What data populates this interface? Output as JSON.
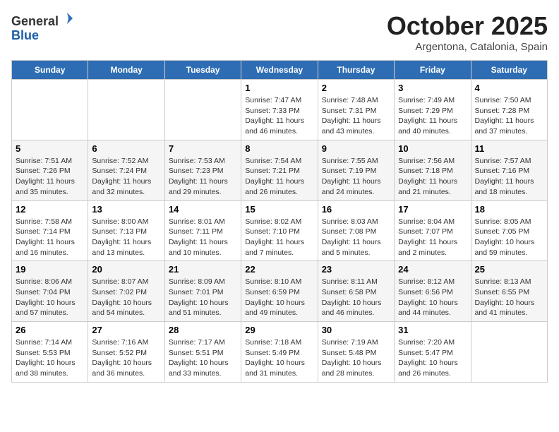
{
  "header": {
    "logo_line1": "General",
    "logo_line2": "Blue",
    "month": "October 2025",
    "location": "Argentona, Catalonia, Spain"
  },
  "days_of_week": [
    "Sunday",
    "Monday",
    "Tuesday",
    "Wednesday",
    "Thursday",
    "Friday",
    "Saturday"
  ],
  "weeks": [
    [
      {
        "day": "",
        "info": ""
      },
      {
        "day": "",
        "info": ""
      },
      {
        "day": "",
        "info": ""
      },
      {
        "day": "1",
        "info": "Sunrise: 7:47 AM\nSunset: 7:33 PM\nDaylight: 11 hours and 46 minutes."
      },
      {
        "day": "2",
        "info": "Sunrise: 7:48 AM\nSunset: 7:31 PM\nDaylight: 11 hours and 43 minutes."
      },
      {
        "day": "3",
        "info": "Sunrise: 7:49 AM\nSunset: 7:29 PM\nDaylight: 11 hours and 40 minutes."
      },
      {
        "day": "4",
        "info": "Sunrise: 7:50 AM\nSunset: 7:28 PM\nDaylight: 11 hours and 37 minutes."
      }
    ],
    [
      {
        "day": "5",
        "info": "Sunrise: 7:51 AM\nSunset: 7:26 PM\nDaylight: 11 hours and 35 minutes."
      },
      {
        "day": "6",
        "info": "Sunrise: 7:52 AM\nSunset: 7:24 PM\nDaylight: 11 hours and 32 minutes."
      },
      {
        "day": "7",
        "info": "Sunrise: 7:53 AM\nSunset: 7:23 PM\nDaylight: 11 hours and 29 minutes."
      },
      {
        "day": "8",
        "info": "Sunrise: 7:54 AM\nSunset: 7:21 PM\nDaylight: 11 hours and 26 minutes."
      },
      {
        "day": "9",
        "info": "Sunrise: 7:55 AM\nSunset: 7:19 PM\nDaylight: 11 hours and 24 minutes."
      },
      {
        "day": "10",
        "info": "Sunrise: 7:56 AM\nSunset: 7:18 PM\nDaylight: 11 hours and 21 minutes."
      },
      {
        "day": "11",
        "info": "Sunrise: 7:57 AM\nSunset: 7:16 PM\nDaylight: 11 hours and 18 minutes."
      }
    ],
    [
      {
        "day": "12",
        "info": "Sunrise: 7:58 AM\nSunset: 7:14 PM\nDaylight: 11 hours and 16 minutes."
      },
      {
        "day": "13",
        "info": "Sunrise: 8:00 AM\nSunset: 7:13 PM\nDaylight: 11 hours and 13 minutes."
      },
      {
        "day": "14",
        "info": "Sunrise: 8:01 AM\nSunset: 7:11 PM\nDaylight: 11 hours and 10 minutes."
      },
      {
        "day": "15",
        "info": "Sunrise: 8:02 AM\nSunset: 7:10 PM\nDaylight: 11 hours and 7 minutes."
      },
      {
        "day": "16",
        "info": "Sunrise: 8:03 AM\nSunset: 7:08 PM\nDaylight: 11 hours and 5 minutes."
      },
      {
        "day": "17",
        "info": "Sunrise: 8:04 AM\nSunset: 7:07 PM\nDaylight: 11 hours and 2 minutes."
      },
      {
        "day": "18",
        "info": "Sunrise: 8:05 AM\nSunset: 7:05 PM\nDaylight: 10 hours and 59 minutes."
      }
    ],
    [
      {
        "day": "19",
        "info": "Sunrise: 8:06 AM\nSunset: 7:04 PM\nDaylight: 10 hours and 57 minutes."
      },
      {
        "day": "20",
        "info": "Sunrise: 8:07 AM\nSunset: 7:02 PM\nDaylight: 10 hours and 54 minutes."
      },
      {
        "day": "21",
        "info": "Sunrise: 8:09 AM\nSunset: 7:01 PM\nDaylight: 10 hours and 51 minutes."
      },
      {
        "day": "22",
        "info": "Sunrise: 8:10 AM\nSunset: 6:59 PM\nDaylight: 10 hours and 49 minutes."
      },
      {
        "day": "23",
        "info": "Sunrise: 8:11 AM\nSunset: 6:58 PM\nDaylight: 10 hours and 46 minutes."
      },
      {
        "day": "24",
        "info": "Sunrise: 8:12 AM\nSunset: 6:56 PM\nDaylight: 10 hours and 44 minutes."
      },
      {
        "day": "25",
        "info": "Sunrise: 8:13 AM\nSunset: 6:55 PM\nDaylight: 10 hours and 41 minutes."
      }
    ],
    [
      {
        "day": "26",
        "info": "Sunrise: 7:14 AM\nSunset: 5:53 PM\nDaylight: 10 hours and 38 minutes."
      },
      {
        "day": "27",
        "info": "Sunrise: 7:16 AM\nSunset: 5:52 PM\nDaylight: 10 hours and 36 minutes."
      },
      {
        "day": "28",
        "info": "Sunrise: 7:17 AM\nSunset: 5:51 PM\nDaylight: 10 hours and 33 minutes."
      },
      {
        "day": "29",
        "info": "Sunrise: 7:18 AM\nSunset: 5:49 PM\nDaylight: 10 hours and 31 minutes."
      },
      {
        "day": "30",
        "info": "Sunrise: 7:19 AM\nSunset: 5:48 PM\nDaylight: 10 hours and 28 minutes."
      },
      {
        "day": "31",
        "info": "Sunrise: 7:20 AM\nSunset: 5:47 PM\nDaylight: 10 hours and 26 minutes."
      },
      {
        "day": "",
        "info": ""
      }
    ]
  ]
}
